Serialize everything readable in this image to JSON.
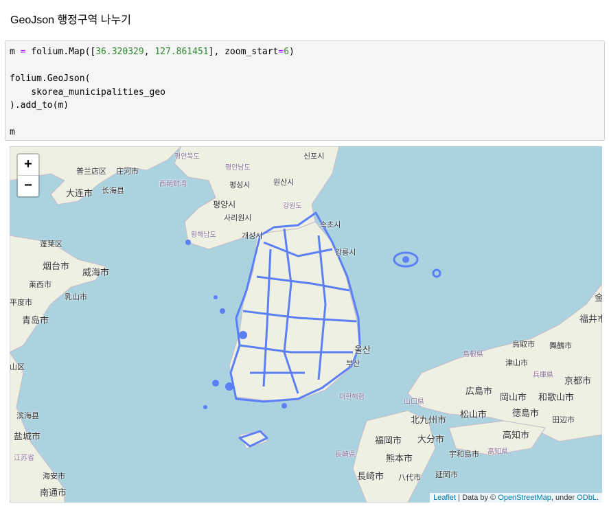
{
  "heading": "GeoJson 행정구역 나누기",
  "code": {
    "l1_a": "m ",
    "l1_eq": "=",
    "l1_b": " folium.Map([",
    "lat": "36.320329",
    "comma": ", ",
    "lon": "127.861451",
    "l1_c": "], zoom_start",
    "l1_eq2": "=",
    "zoom": "6",
    "l1_d": ")",
    "l2": "folium.GeoJson(",
    "l3": "    skorea_municipalities_geo",
    "l4": ").add_to(m)",
    "l5": "m"
  },
  "map": {
    "zoom_in": "+",
    "zoom_out": "−",
    "attribution": {
      "leaflet": "Leaflet",
      "sep": " | Data by © ",
      "osm": "OpenStreetMap",
      "under": ", under ",
      "odbl": "ODbL",
      "end": "."
    },
    "geojson_color": "#5b7ff6",
    "labels": [
      "평안북도",
      "신포시",
      "普兰店区",
      "庄河市",
      "평안남도",
      "원산시",
      "大连市",
      "长海县",
      "평성시",
      "평양시",
      "강원도",
      "사리원시",
      "황해남도",
      "개성시",
      "속초시",
      "강릉시",
      "蓬莱区",
      "烟台市",
      "威海市",
      "莱西市",
      "乳山市",
      "平度市",
      "青岛市",
      "山区",
      "滨海县",
      "盐城市",
      "江苏省",
      "海安市",
      "南通市",
      "울산",
      "부산",
      "대한해협",
      "鳥取市",
      "舞鶴市",
      "島根県",
      "津山市",
      "兵庫県",
      "京都市",
      "広島市",
      "岡山市",
      "和歌山市",
      "山口県",
      "北九州市",
      "松山市",
      "徳島市",
      "田辺市",
      "福岡市",
      "大分市",
      "高知市",
      "熊本市",
      "宇和島市",
      "高知県",
      "長崎県",
      "長崎市",
      "八代市",
      "延岡市",
      "福井市",
      "金",
      "西朝鲜湾"
    ]
  }
}
